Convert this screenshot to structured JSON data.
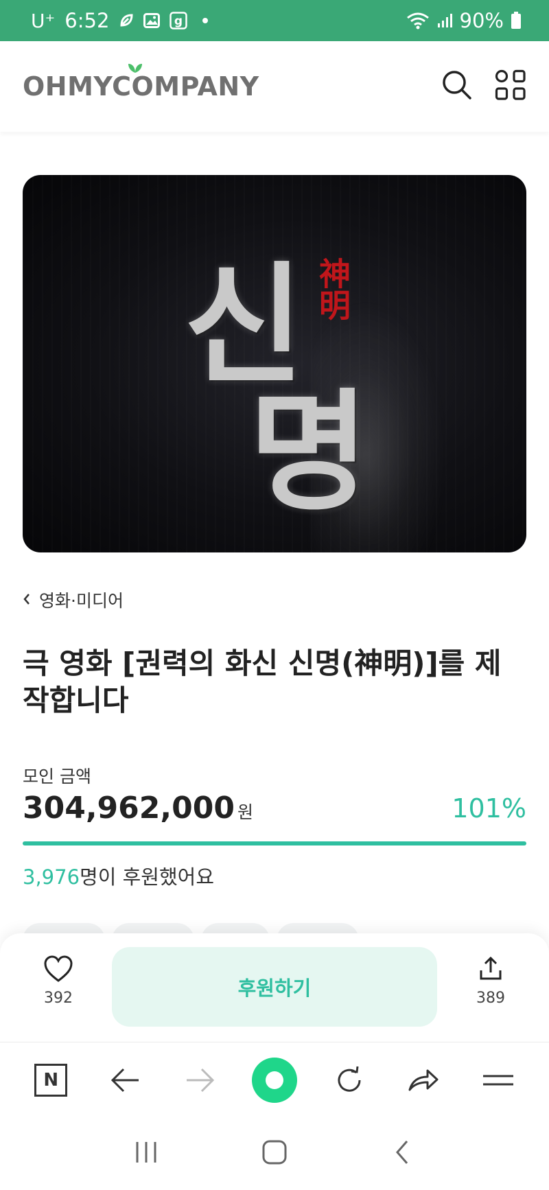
{
  "status_bar": {
    "carrier": "U⁺",
    "time": "6:52",
    "battery": "90%",
    "icons": [
      "leaf-icon",
      "gallery-icon",
      "g-app-icon",
      "notification-dot",
      "wifi-icon",
      "signal-icon",
      "battery-icon"
    ]
  },
  "header": {
    "logo": "OHMYCOMPANY",
    "actions": [
      "search-icon",
      "menu-grid-icon"
    ]
  },
  "hero": {
    "title_syllable_1": "신",
    "title_syllable_2": "명",
    "hanja": "神明"
  },
  "breadcrumb": {
    "label": "영화·미디어"
  },
  "project": {
    "title": "극 영화 [권력의 화신 신명(神明)]를 제작합니다"
  },
  "funding": {
    "label": "모인 금액",
    "amount": "304,962,000",
    "unit": "원",
    "percent_text": "101%",
    "progress": 1.0,
    "supporters_count": "3,976",
    "supporters_suffix": "명이 후원했어요"
  },
  "actions": {
    "like_count": "392",
    "support_label": "후원하기",
    "share_count": "389"
  },
  "colors": {
    "brand_green": "#3aa876",
    "accent_teal": "#2fbfa0",
    "button_bg": "#e5f7f1",
    "home_green": "#1fd68a"
  }
}
